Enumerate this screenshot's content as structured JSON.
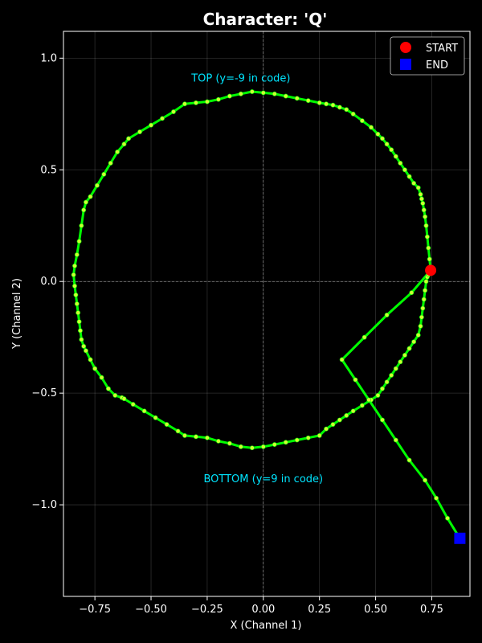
{
  "chart_data": {
    "type": "line",
    "title": "Character: 'Q'",
    "xlabel": "X (Channel 1)",
    "ylabel": "Y (Channel 2)",
    "xlim": [
      -0.89,
      0.92
    ],
    "ylim": [
      -1.41,
      1.12
    ],
    "xticks": [
      -0.75,
      -0.5,
      -0.25,
      0.0,
      0.25,
      0.5,
      0.75
    ],
    "xtick_labels": [
      "−0.75",
      "−0.50",
      "−0.25",
      "0.00",
      "0.25",
      "0.50",
      "0.75"
    ],
    "yticks": [
      -1.0,
      -0.5,
      0.0,
      0.5,
      1.0
    ],
    "ytick_labels": [
      "−1.0",
      "−0.5",
      "0.0",
      "0.5",
      "1.0"
    ],
    "grid": true,
    "line_color": "#00ff00",
    "point_color": "#ccff33",
    "background": "#000000",
    "annotations": [
      {
        "text": "TOP (y=-9 in code)",
        "x": -0.1,
        "y": 0.91
      },
      {
        "text": "BOTTOM (y=9 in code)",
        "x": 0.0,
        "y": -0.885
      }
    ],
    "legend": {
      "placement": "top-right",
      "entries": [
        {
          "label": "START",
          "color": "#ff0000",
          "marker": "circle"
        },
        {
          "label": "END",
          "color": "#0000ff",
          "marker": "square"
        }
      ]
    },
    "start_point": {
      "x": 0.745,
      "y": 0.05
    },
    "end_point": {
      "x": 0.875,
      "y": -1.15
    },
    "series": [
      {
        "x": [
          0.745,
          0.74,
          0.735,
          0.73,
          0.725,
          0.72,
          0.715,
          0.71,
          0.705,
          0.7,
          0.69,
          0.67,
          0.65,
          0.63,
          0.61,
          0.59,
          0.57,
          0.55,
          0.53,
          0.51,
          0.48,
          0.44,
          0.4,
          0.37,
          0.34,
          0.31,
          0.28,
          0.25,
          0.2,
          0.15,
          0.1,
          0.05,
          0.0,
          -0.05,
          -0.1,
          -0.15,
          -0.2,
          -0.25,
          -0.3,
          -0.35,
          -0.4,
          -0.45,
          -0.5,
          -0.55,
          -0.6,
          -0.62,
          -0.65,
          -0.68,
          -0.71,
          -0.74,
          -0.77,
          -0.79,
          -0.8,
          -0.81,
          -0.82,
          -0.83,
          -0.84,
          -0.845,
          -0.84,
          -0.835,
          -0.83,
          -0.825,
          -0.82,
          -0.815,
          -0.81,
          -0.8,
          -0.79,
          -0.77,
          -0.75,
          -0.72,
          -0.69,
          -0.66,
          -0.63,
          -0.62,
          -0.58,
          -0.53,
          -0.48,
          -0.43,
          -0.38,
          -0.35,
          -0.3,
          -0.25,
          -0.2,
          -0.15,
          -0.1,
          -0.05,
          0.0,
          0.05,
          0.1,
          0.15,
          0.2,
          0.25,
          0.28,
          0.31,
          0.34,
          0.37,
          0.4,
          0.44,
          0.48,
          0.51,
          0.53,
          0.55,
          0.57,
          0.59,
          0.61,
          0.63,
          0.65,
          0.67,
          0.69,
          0.7,
          0.705,
          0.71,
          0.715,
          0.72,
          0.725,
          0.73,
          0.735,
          0.74,
          0.745,
          0.66,
          0.55,
          0.45,
          0.35,
          0.41,
          0.47,
          0.53,
          0.59,
          0.65,
          0.72,
          0.77,
          0.82,
          0.875
        ],
        "y": [
          0.05,
          0.1,
          0.15,
          0.2,
          0.25,
          0.29,
          0.32,
          0.35,
          0.37,
          0.39,
          0.42,
          0.44,
          0.47,
          0.5,
          0.53,
          0.56,
          0.59,
          0.615,
          0.64,
          0.66,
          0.69,
          0.72,
          0.75,
          0.77,
          0.78,
          0.79,
          0.795,
          0.8,
          0.81,
          0.82,
          0.83,
          0.84,
          0.845,
          0.85,
          0.84,
          0.83,
          0.815,
          0.805,
          0.8,
          0.795,
          0.76,
          0.73,
          0.7,
          0.67,
          0.64,
          0.615,
          0.58,
          0.53,
          0.48,
          0.43,
          0.38,
          0.355,
          0.32,
          0.25,
          0.18,
          0.12,
          0.07,
          0.03,
          -0.02,
          -0.06,
          -0.1,
          -0.14,
          -0.18,
          -0.22,
          -0.26,
          -0.29,
          -0.31,
          -0.35,
          -0.39,
          -0.43,
          -0.48,
          -0.51,
          -0.52,
          -0.525,
          -0.55,
          -0.58,
          -0.61,
          -0.64,
          -0.67,
          -0.69,
          -0.695,
          -0.7,
          -0.715,
          -0.725,
          -0.74,
          -0.745,
          -0.74,
          -0.73,
          -0.72,
          -0.71,
          -0.7,
          -0.69,
          -0.66,
          -0.64,
          -0.62,
          -0.6,
          -0.58,
          -0.555,
          -0.53,
          -0.51,
          -0.48,
          -0.45,
          -0.42,
          -0.39,
          -0.36,
          -0.33,
          -0.3,
          -0.27,
          -0.24,
          -0.2,
          -0.16,
          -0.12,
          -0.08,
          -0.04,
          0.0,
          0.02,
          0.03,
          0.04,
          0.05,
          -0.05,
          -0.15,
          -0.25,
          -0.35,
          -0.44,
          -0.53,
          -0.62,
          -0.71,
          -0.8,
          -0.89,
          -0.97,
          -1.06,
          -1.15
        ]
      }
    ]
  }
}
